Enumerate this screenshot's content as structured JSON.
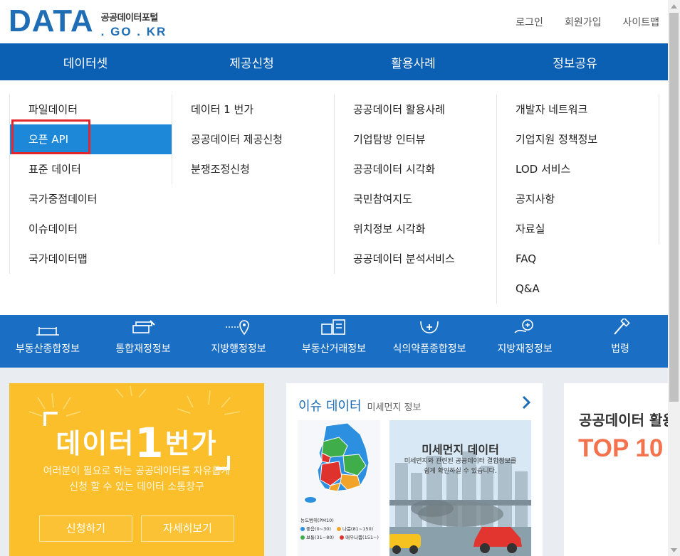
{
  "header": {
    "logo_main": "DATA",
    "logo_korean": "공공데이터포털",
    "logo_domain": ". GO . KR",
    "util_links": [
      "로그인",
      "회원가입",
      "사이트맵"
    ]
  },
  "gnb": {
    "items": [
      "데이터셋",
      "제공신청",
      "활용사례",
      "정보공유"
    ]
  },
  "mega_menu": {
    "col1": [
      "파일데이터",
      "오픈 API",
      "표준 데이터",
      "국가중점데이터",
      "이슈데이터",
      "국가데이터맵"
    ],
    "col2": [
      "데이터 1 번가",
      "공공데이터 제공신청",
      "분쟁조정신청"
    ],
    "col3": [
      "공공데이터 활용사례",
      "기업탐방 인터뷰",
      "공공데이터 시각화",
      "국민참여지도",
      "위치정보 시각화",
      "공공데이터 분석서비스"
    ],
    "col4": [
      "개발자 네트워크",
      "기업지원 정책정보",
      "LOD 서비스",
      "공지사항",
      "자료실",
      "FAQ",
      "Q&A"
    ],
    "active_item": "오픈 API"
  },
  "quick_links": [
    {
      "label": "부동산종합정보",
      "icon": "document-icon"
    },
    {
      "label": "통합재정정보",
      "icon": "money-stack-icon"
    },
    {
      "label": "지방행정정보",
      "icon": "location-pin-icon"
    },
    {
      "label": "부동산거래정보",
      "icon": "building-icon"
    },
    {
      "label": "식의약품종합정보",
      "icon": "medical-icon"
    },
    {
      "label": "지방재정정보",
      "icon": "coin-hand-icon"
    },
    {
      "label": "법령",
      "icon": "gavel-icon"
    }
  ],
  "card_data1": {
    "title_pre": "데이터",
    "title_num": "1",
    "title_post": "번가",
    "desc_line1": "여러분이 필요로 하는 공공데이터를 자유롭게",
    "desc_line2": "신청 할 수 있는 데이터 소통창구",
    "btn_apply": "신청하기",
    "btn_more": "자세히보기"
  },
  "card_issue": {
    "title": "이슈 데이터",
    "subtitle": "미세먼지 정보",
    "pic_title": "미세먼지 데이터",
    "pic_desc_line1": "미세먼지와 관련된 공공데이터 결합정보를",
    "pic_desc_line2": "쉽게 확인하실 수 있습니다.",
    "legend_title": "농도범위(PM10)",
    "legend": [
      {
        "label": "좋음(0~30)",
        "color": "#2c8fe0"
      },
      {
        "label": "나쁨(81~150)",
        "color": "#f2a42a"
      },
      {
        "label": "보통(31~80)",
        "color": "#3fae4a"
      },
      {
        "label": "매우나쁨(151~)",
        "color": "#e0322c"
      }
    ]
  },
  "card_top": {
    "title": "공공데이터 활용",
    "top": "TOP 10"
  }
}
